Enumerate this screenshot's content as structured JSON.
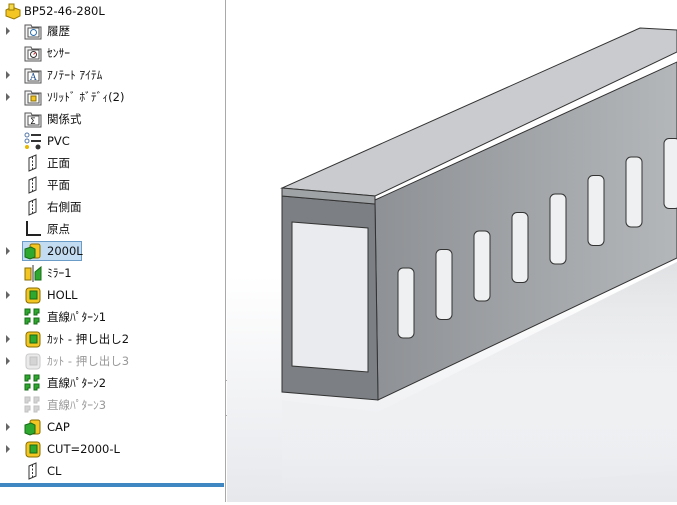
{
  "tree": {
    "root": "BP52-46-280L",
    "items": [
      {
        "label": "履歴",
        "icon": "history-folder-icon",
        "expand": true
      },
      {
        "label": "ｾﾝｻｰ",
        "icon": "sensor-folder-icon",
        "expand": false
      },
      {
        "label": "ｱﾉﾃｰﾄ ｱｲﾃﾑ",
        "icon": "annotation-folder-icon",
        "expand": true
      },
      {
        "label": "ｿﾘｯﾄﾞ ﾎﾞﾃﾞｨ(2)",
        "icon": "solid-bodies-folder-icon",
        "expand": true
      },
      {
        "label": "関係式",
        "icon": "equations-folder-icon",
        "expand": false
      },
      {
        "label": "PVC",
        "icon": "material-icon",
        "expand": false
      },
      {
        "label": "正面",
        "icon": "plane-icon",
        "expand": false
      },
      {
        "label": "平面",
        "icon": "plane-icon",
        "expand": false
      },
      {
        "label": "右側面",
        "icon": "plane-icon",
        "expand": false
      },
      {
        "label": "原点",
        "icon": "origin-icon",
        "expand": false
      },
      {
        "label": "2000L",
        "icon": "extrude-icon",
        "expand": true,
        "selected": true
      },
      {
        "label": "ﾐﾗｰ1",
        "icon": "mirror-icon",
        "expand": false
      },
      {
        "label": "HOLL",
        "icon": "cut-extrude-icon",
        "expand": true
      },
      {
        "label": "直線ﾊﾟﾀｰﾝ1",
        "icon": "linear-pattern-icon",
        "expand": false
      },
      {
        "label": "ｶｯﾄ - 押し出し2",
        "icon": "cut-extrude-icon",
        "expand": true
      },
      {
        "label": "ｶｯﾄ - 押し出し3",
        "icon": "cut-extrude-icon",
        "expand": true,
        "suppressed": true
      },
      {
        "label": "直線ﾊﾟﾀｰﾝ2",
        "icon": "linear-pattern-icon",
        "expand": false
      },
      {
        "label": "直線ﾊﾟﾀｰﾝ3",
        "icon": "linear-pattern-icon",
        "expand": false,
        "suppressed": true
      },
      {
        "label": "CAP",
        "icon": "extrude-icon",
        "expand": true
      },
      {
        "label": "CUT=2000-L",
        "icon": "cut-extrude-icon",
        "expand": true
      },
      {
        "label": "CL",
        "icon": "plane-icon",
        "expand": false
      }
    ]
  },
  "colors": {
    "selection": "#c4dcf2",
    "rollback_bar": "#3f87c2",
    "feature_yellow": "#f1c40f",
    "feature_green": "#2ea82e"
  }
}
